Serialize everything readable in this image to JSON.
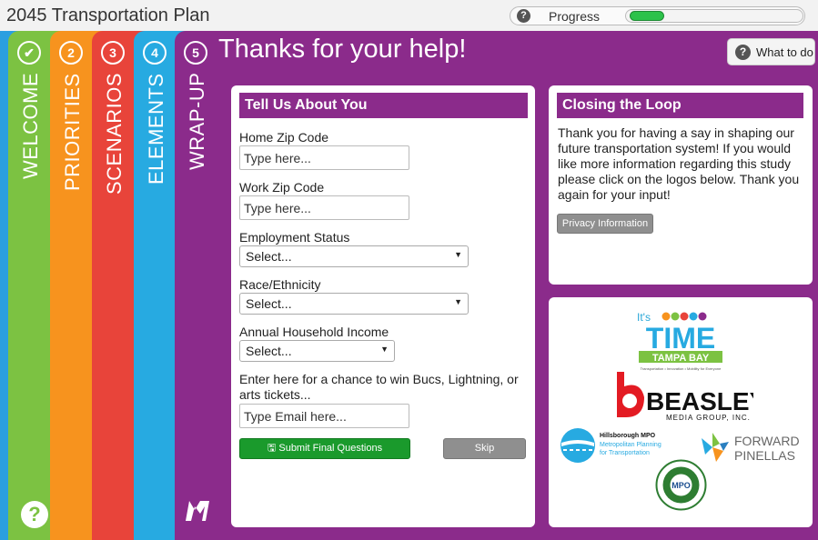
{
  "app": {
    "title": "2045 Transportation Plan",
    "progress_label": "Progress",
    "progress_fraction": 0.2
  },
  "tabs": [
    {
      "badge": "✔",
      "label": "WELCOME"
    },
    {
      "badge": "2",
      "label": "PRIORITIES"
    },
    {
      "badge": "3",
      "label": "SCENARIOS"
    },
    {
      "badge": "4",
      "label": "ELEMENTS"
    },
    {
      "badge": "5",
      "label": "WRAP-UP"
    }
  ],
  "main": {
    "title": "Thanks for your help!",
    "what_todo": "What to do"
  },
  "form": {
    "heading": "Tell Us About You",
    "home_zip_label": "Home Zip Code",
    "home_zip_placeholder": "Type here...",
    "work_zip_label": "Work Zip Code",
    "work_zip_placeholder": "Type here...",
    "employment_label": "Employment Status",
    "employment_value": "Select...",
    "race_label": "Race/Ethnicity",
    "race_value": "Select...",
    "income_label": "Annual Household Income",
    "income_value": "Select...",
    "email_prompt": "Enter here for a chance to win Bucs, Lightning, or arts tickets...",
    "email_placeholder": "Type Email here...",
    "submit_label": "Submit Final Questions",
    "skip_label": "Skip"
  },
  "closing": {
    "heading": "Closing the Loop",
    "text": "Thank you for having a say in shaping our future transportation system! If you would like more information regarding this study please click on the logos below. Thank you again for your input!",
    "privacy_label": "Privacy Information"
  },
  "logos": {
    "time_its": "It's",
    "time_word": "TIME",
    "time_sub": "TAMPA BAY",
    "time_tagline": "Transportation • Innovation • Mobility for Everyone",
    "beasley_word": "BEASLEY",
    "beasley_sub": "MEDIA GROUP, INC.",
    "hillsborough_title": "Hillsborough MPO",
    "hillsborough_sub1": "Metropolitan Planning",
    "hillsborough_sub2": "for Transportation",
    "forward_line1": "FORWARD",
    "forward_line2": "PINELLAS",
    "pasco_center": "MPO"
  },
  "colors": {
    "welcome": "#7cc242",
    "priorities": "#f7931e",
    "scenarios": "#e8443a",
    "elements": "#27aae1",
    "wrapup": "#8b2b8b",
    "submit": "#1a9a2c"
  }
}
